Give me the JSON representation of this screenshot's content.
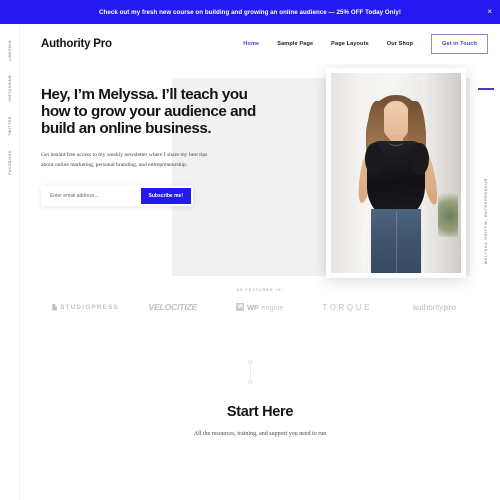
{
  "notice": {
    "text": "Check out my fresh new course on building and growing an online audience — 25% OFF Today Only!",
    "close_icon": "close-icon",
    "close_glyph": "×",
    "background": "#2419ee"
  },
  "left_rail": {
    "items": [
      {
        "label": "LinkedIn"
      },
      {
        "label": "Instagram"
      },
      {
        "label": "Twitter"
      },
      {
        "label": "Facebook"
      }
    ]
  },
  "right_rail": {
    "label": "Melyssa Griffin, Entrepreneur",
    "dash_color": "#3f3fb0"
  },
  "header": {
    "brand": "Authority Pro",
    "nav": [
      {
        "label": "Home",
        "active": true
      },
      {
        "label": "Sample Page",
        "active": false
      },
      {
        "label": "Page Layouts",
        "active": false
      },
      {
        "label": "Our Shop",
        "active": false
      }
    ],
    "cta_label": "Get in Touch",
    "accent": "#4444cf"
  },
  "hero": {
    "title": "Hey, I’m Melyssa. I’ll teach you how to grow your audience and build an online business.",
    "subtitle": "Get instant free access to my weekly newsletter where I share my best tips about online marketing, personal branding, and entrepreneurship.",
    "form": {
      "placeholder": "Enter email address...",
      "value": "",
      "button_label": "Subscribe me!",
      "button_color": "#2419ee"
    },
    "photo_alt": "Portrait of Melyssa standing in a bright hallway, hands on hips"
  },
  "featured": {
    "label": "AS FEATURED IN:",
    "logos": [
      {
        "name": "StudioPress",
        "text": "STUDIOPRESS"
      },
      {
        "name": "Velocitize",
        "text": "VELOCITIZE"
      },
      {
        "name": "WP Engine",
        "mark": "W",
        "bold": "WP",
        "light": "engine"
      },
      {
        "name": "Torque",
        "text": "TORQUE"
      },
      {
        "name": "Authority Pro",
        "part_a": "authority",
        "part_b": "pro"
      }
    ]
  },
  "scroll_indicator": {
    "name": "scroll-down-indicator"
  },
  "start_section": {
    "title": "Start Here",
    "subtitle": "All the resources, training, and support you need to run"
  }
}
